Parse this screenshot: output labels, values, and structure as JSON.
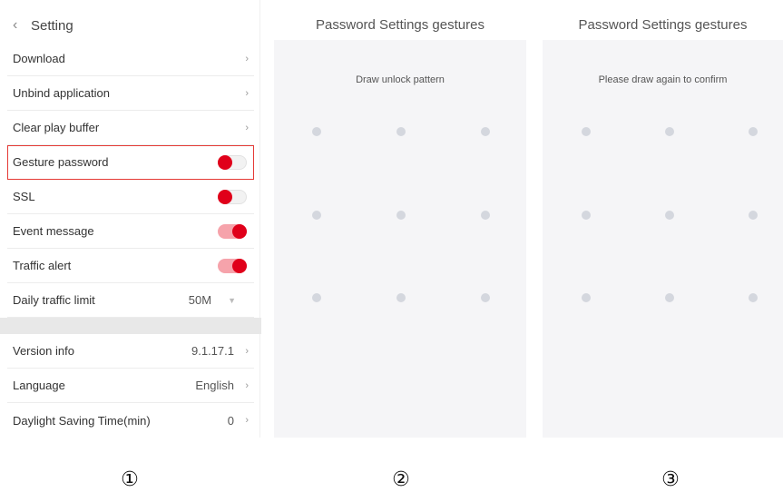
{
  "settings": {
    "header": {
      "back_glyph": "<",
      "title": "Setting"
    },
    "rows": {
      "download": {
        "label": "Download"
      },
      "unbind": {
        "label": "Unbind application"
      },
      "clear_buffer": {
        "label": "Clear play buffer"
      },
      "gesture_password": {
        "label": "Gesture password",
        "toggle_on": false
      },
      "ssl": {
        "label": "SSL",
        "toggle_on": false
      },
      "event_message": {
        "label": "Event message",
        "toggle_on": true
      },
      "traffic_alert": {
        "label": "Traffic alert",
        "toggle_on": true
      },
      "daily_limit": {
        "label": "Daily traffic limit",
        "value": "50M"
      },
      "version": {
        "label": "Version info",
        "value": "9.1.17.1"
      },
      "language": {
        "label": "Language",
        "value": "English"
      },
      "dst": {
        "label": "Daylight Saving Time(min)",
        "value": "0"
      }
    },
    "highlight_color": "#e53935",
    "toggle_knob_color": "#e0001a"
  },
  "gesture_1": {
    "title": "Password Settings gestures",
    "hint": "Draw unlock pattern"
  },
  "gesture_2": {
    "title": "Password Settings gestures",
    "hint": "Please draw again to confirm"
  },
  "steps": {
    "one": "①",
    "two": "②",
    "three": "③"
  },
  "icons": {
    "chevron": "chevron-right-icon",
    "back": "back-arrow-icon",
    "dropdown": "caret-down-icon"
  }
}
